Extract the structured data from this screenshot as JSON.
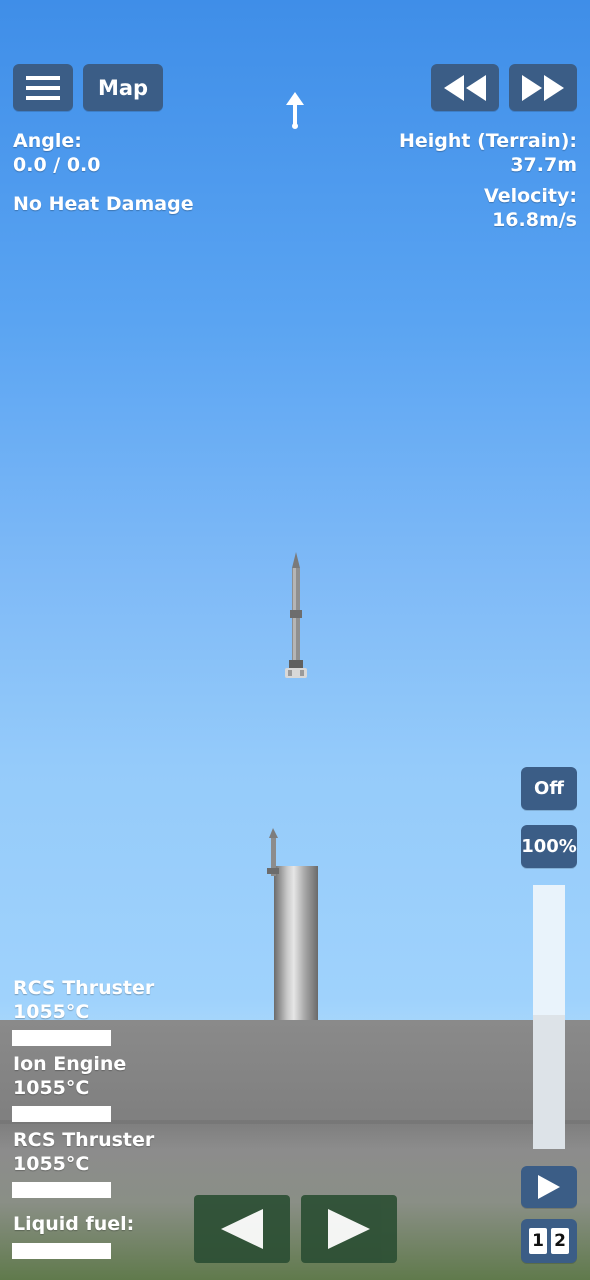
{
  "hud": {
    "menu_icon": "hamburger-menu-icon",
    "map_label": "Map",
    "rewind_icon": "rewind-icon",
    "fast_forward_icon": "fast-forward-icon",
    "direction_icon": "up-arrow-icon"
  },
  "telemetry": {
    "angle_label": "Angle:",
    "angle_value": "0.0 / 0.0",
    "heat_status": "No Heat Damage",
    "height_label": "Height (Terrain):",
    "height_value": "37.7m",
    "velocity_label": "Velocity:",
    "velocity_value": "16.8m/s"
  },
  "controls": {
    "rcs_toggle_label": "Off",
    "throttle_label": "100%",
    "throttle_level": 1.0,
    "play_icon": "play-icon",
    "stage_icon_left": "1",
    "stage_icon_right": "2",
    "rotate_left_icon": "left-arrow-icon",
    "rotate_right_icon": "right-arrow-icon"
  },
  "parts": [
    {
      "name": "RCS Thruster",
      "temp": "1055°C"
    },
    {
      "name": "Ion Engine",
      "temp": "1055°C"
    },
    {
      "name": "RCS Thruster",
      "temp": "1055°C"
    }
  ],
  "fuel": {
    "label": "Liquid fuel:"
  },
  "colors": {
    "button_bg": "#3b5d86",
    "sky_top": "#3f8ee8",
    "sky_bottom": "#a6d6fb",
    "ground": "#8a8a8a"
  }
}
